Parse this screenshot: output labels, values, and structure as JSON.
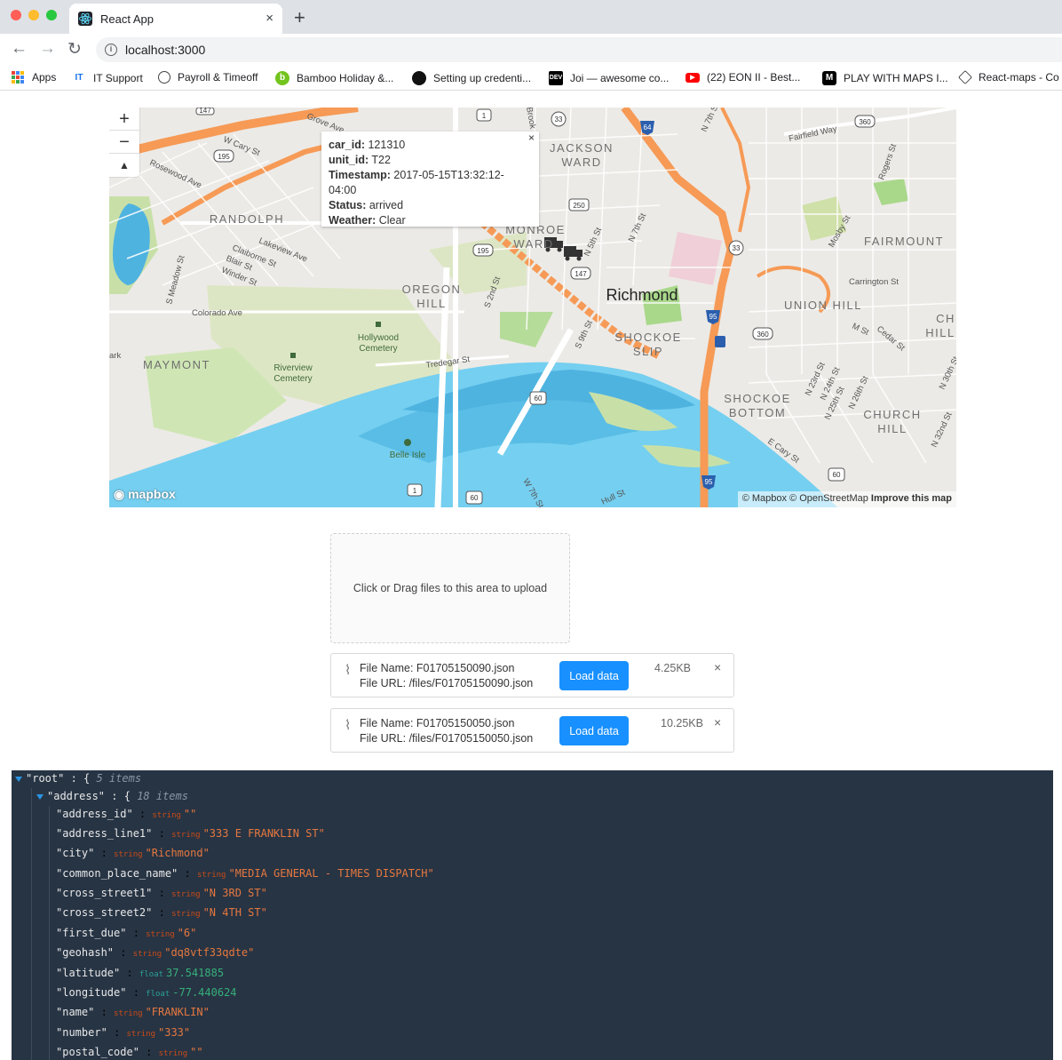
{
  "browser": {
    "tab_title": "React App",
    "tab_close": "×",
    "new_tab": "+",
    "url": "localhost:3000",
    "nav": {
      "back": "←",
      "forward": "→",
      "reload": "↻"
    },
    "bookmarks": [
      {
        "label": "Apps",
        "icon": "apps-grid-icon"
      },
      {
        "label": "IT Support",
        "icon_text": "IT",
        "color": "#1a73e8"
      },
      {
        "label": "Payroll & Timeoff",
        "icon": "globe-icon"
      },
      {
        "label": "Bamboo Holiday &...",
        "icon_text": "b",
        "color": "#73c41d"
      },
      {
        "label": "Setting up credenti...",
        "icon": "github-icon"
      },
      {
        "label": "Joi — awesome co...",
        "icon_text": "DEV",
        "color": "#000000"
      },
      {
        "label": "(22) EON II - Best...",
        "icon": "youtube-icon",
        "color": "#ff0000"
      },
      {
        "label": "PLAY WITH MAPS I...",
        "icon_text": "M",
        "color": "#000000"
      },
      {
        "label": "React-maps - Co",
        "icon": "codesandbox-icon"
      }
    ]
  },
  "map": {
    "zoom_in": "+",
    "zoom_out": "−",
    "compass": "▲",
    "popup": {
      "close": "×",
      "fields": [
        {
          "label": "car_id:",
          "value": "121310"
        },
        {
          "label": "unit_id:",
          "value": "T22"
        },
        {
          "label": "Timestamp:",
          "value": "2017-05-15T13:32:12-04:00"
        },
        {
          "label": "Status:",
          "value": "arrived"
        },
        {
          "label": "Weather:",
          "value": "Clear"
        }
      ]
    },
    "city_label": "Richmond",
    "neighborhoods": [
      "JACKSON",
      "WARD",
      "RANDOLPH",
      "FAIRMOUNT",
      "MONROE",
      "WARD",
      "OREGON",
      "HILL",
      "UNION HILL",
      "SHOCKOE",
      "SLIP",
      "MAYMONT",
      "SHOCKOE",
      "BOTTOM",
      "CHURCH",
      "HILL",
      "CH",
      "HILL"
    ],
    "streets": [
      "Grove Ave",
      "W Cary St",
      "Rosewood Ave",
      "Lakeview Ave",
      "Claiborne St",
      "Blair St",
      "Winder St",
      "S Meadow St",
      "Colorado Ave",
      "Tredegar St",
      "S 2nd St",
      "N 5th St",
      "N 7th St",
      "S 9th St",
      "Fairfield Way",
      "Mosby St",
      "Rogers St",
      "Carrington St",
      "M St",
      "Cedar St",
      "N 23rd St",
      "N 24th St",
      "N 25th St",
      "N 26th St",
      "N 30th St",
      "N 32nd St",
      "E Cary St",
      "Hull St",
      "W 7th St",
      "Brook",
      "N 7th S",
      "ark"
    ],
    "pois": [
      "Hollywood",
      "Cemetery",
      "Riverview",
      "Cemetery",
      "Belle Isle"
    ],
    "shields": [
      "147",
      "1",
      "33",
      "64",
      "360",
      "195",
      "250",
      "195",
      "147",
      "33",
      "95",
      "360",
      "60",
      "95",
      "1",
      "60",
      "60"
    ],
    "logo": "mapbox",
    "attribution": "© Mapbox © OpenStreetMap",
    "attribution_link": "Improve this map"
  },
  "upload": {
    "dropzone_text": "Click or Drag files to this area to upload",
    "files": [
      {
        "name_line": "File Name: F01705150090.json",
        "url_line": "File URL: /files/F01705150090.json",
        "button": "Load data",
        "size": "4.25KB",
        "remove": "×"
      },
      {
        "name_line": "File Name: F01705150050.json",
        "url_line": "File URL: /files/F01705150050.json",
        "button": "Load data",
        "size": "10.25KB",
        "remove": "×"
      }
    ]
  },
  "json_viewer": {
    "root": {
      "key": "\"root\"",
      "brace": ": {",
      "count": "5 items"
    },
    "address": {
      "key": "\"address\"",
      "brace": ": {",
      "count": "18 items"
    },
    "fields": [
      {
        "key": "\"address_id\"",
        "type": "string",
        "value": "\"\""
      },
      {
        "key": "\"address_line1\"",
        "type": "string",
        "value": "\"333 E FRANKLIN ST\""
      },
      {
        "key": "\"city\"",
        "type": "string",
        "value": "\"Richmond\""
      },
      {
        "key": "\"common_place_name\"",
        "type": "string",
        "value": "\"MEDIA GENERAL - TIMES DISPATCH\""
      },
      {
        "key": "\"cross_street1\"",
        "type": "string",
        "value": "\"N 3RD ST\""
      },
      {
        "key": "\"cross_street2\"",
        "type": "string",
        "value": "\"N 4TH ST\""
      },
      {
        "key": "\"first_due\"",
        "type": "string",
        "value": "\"6\""
      },
      {
        "key": "\"geohash\"",
        "type": "string",
        "value": "\"dq8vtf33qdte\""
      },
      {
        "key": "\"latitude\"",
        "type": "float",
        "value": "37.541885"
      },
      {
        "key": "\"longitude\"",
        "type": "float",
        "value": "-77.440624"
      },
      {
        "key": "\"name\"",
        "type": "string",
        "value": "\"FRANKLIN\""
      },
      {
        "key": "\"number\"",
        "type": "string",
        "value": "\"333\""
      },
      {
        "key": "\"postal_code\"",
        "type": "string",
        "value": "\"\""
      }
    ]
  }
}
